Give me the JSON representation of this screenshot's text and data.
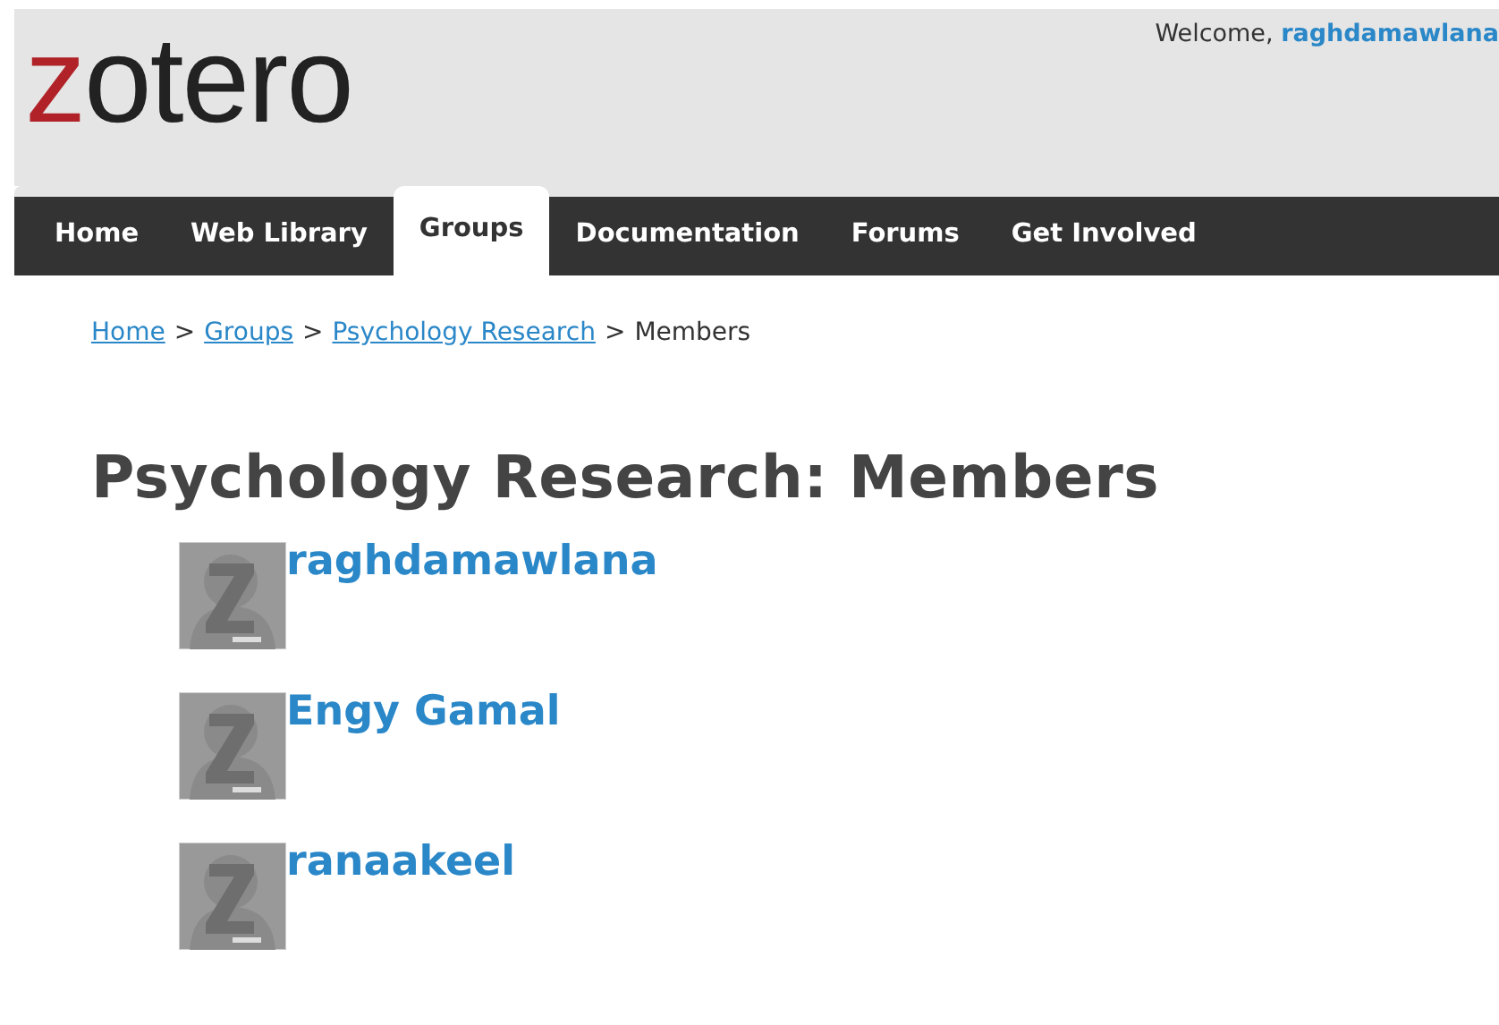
{
  "header": {
    "logo": {
      "accent": "z",
      "rest": "otero"
    },
    "welcome": "Welcome,",
    "username": "raghdamawlana"
  },
  "nav": [
    {
      "label": "Home",
      "selected": false
    },
    {
      "label": "Web Library",
      "selected": false
    },
    {
      "label": "Groups",
      "selected": true
    },
    {
      "label": "Documentation",
      "selected": false
    },
    {
      "label": "Forums",
      "selected": false
    },
    {
      "label": "Get Involved",
      "selected": false
    }
  ],
  "breadcrumb": {
    "links": [
      "Home",
      "Groups",
      "Psychology Research"
    ],
    "separator": ">",
    "current": "Members"
  },
  "title": "Psychology Research: Members",
  "members": [
    {
      "name": "raghdamawlana"
    },
    {
      "name": "Engy Gamal"
    },
    {
      "name": "ranaakeel"
    }
  ]
}
